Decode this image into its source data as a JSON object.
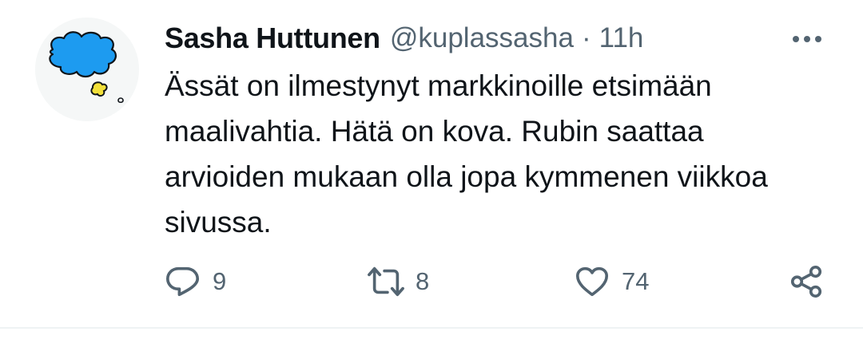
{
  "tweet": {
    "author": {
      "display_name": "Sasha Huttunen",
      "handle": "@kuplassasha",
      "avatar_icon": "cloud-icon"
    },
    "separator": "·",
    "time": "11h",
    "text": "Ässät on ilmestynyt markkinoille etsimään\nmaalivahtia. Hätä on kova. Rubin saattaa\narvioiden mukaan olla jopa kymmenen viikkoa\nsivussa.",
    "actions": {
      "replies": {
        "icon": "reply-icon",
        "count": "9"
      },
      "retweets": {
        "icon": "retweet-icon",
        "count": "8"
      },
      "likes": {
        "icon": "heart-icon",
        "count": "74"
      },
      "share": {
        "icon": "share-icon"
      }
    },
    "more_icon": "more-icon"
  },
  "colors": {
    "text_primary": "#0f1419",
    "text_secondary": "#536471",
    "avatar_cloud": "#1d9bf0",
    "avatar_blob": "#f2e03a",
    "divider": "#eff3f4"
  }
}
